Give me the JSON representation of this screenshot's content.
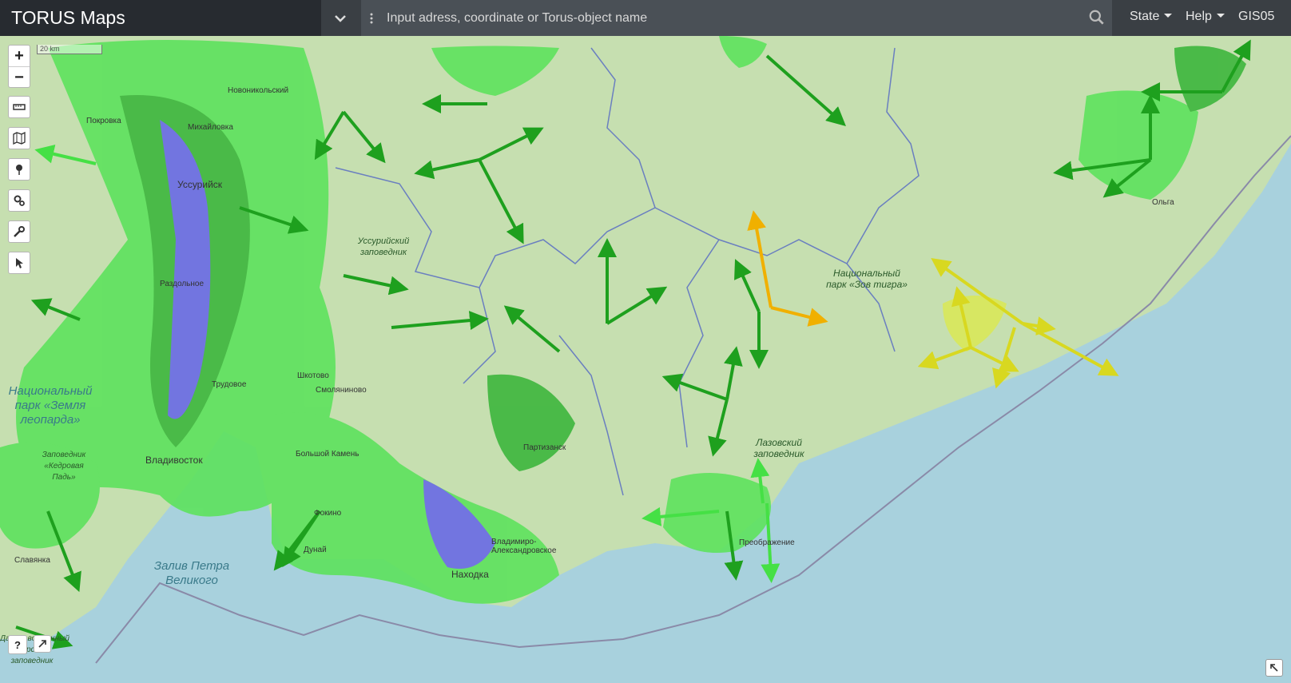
{
  "header": {
    "title": "TORUS Maps",
    "search_placeholder": "Input adress, coordinate or Torus-object name",
    "menu_state": "State",
    "menu_help": "Help",
    "user": "GIS05"
  },
  "map": {
    "scale_label": "20 km",
    "zoom_in": "+",
    "zoom_out": "−",
    "help_button": "?",
    "labels": {
      "ussuri_reserve": "Уссурийский заповедник",
      "zov_tigra": "Национальный парк «Зов тигра»",
      "lazovsky": "Лазовский заповедник",
      "zemlya_leoparda": "Национальный парк «Земля леопарда»",
      "kedrovaya_pad": "Заповедник «Кедровая Падь»",
      "zaliv_petra": "Залив Петра Великого",
      "marine_reserve": "Дальневосточный морской заповедник"
    },
    "cities": {
      "novonikolsk": "Новоникольский",
      "pokrovka": "Покровка",
      "mikhaylovka": "Михайловка",
      "ussuriysk": "Уссурийск",
      "razdolnoe": "Раздольное",
      "shkotovo": "Шкотово",
      "trudovoe": "Трудовое",
      "smolyaninovo": "Смоляниново",
      "vladivostok": "Владивосток",
      "bolshoy_kamen": "Большой Камень",
      "fokino": "Фокино",
      "dunay": "Дунай",
      "slavyanka": "Славянка",
      "nakhodka": "Находка",
      "vladimiro": "Владимиро-Александровское",
      "partizansk": "Партизанск",
      "preobrazhenie": "Преображение",
      "olga": "Ольга"
    }
  }
}
